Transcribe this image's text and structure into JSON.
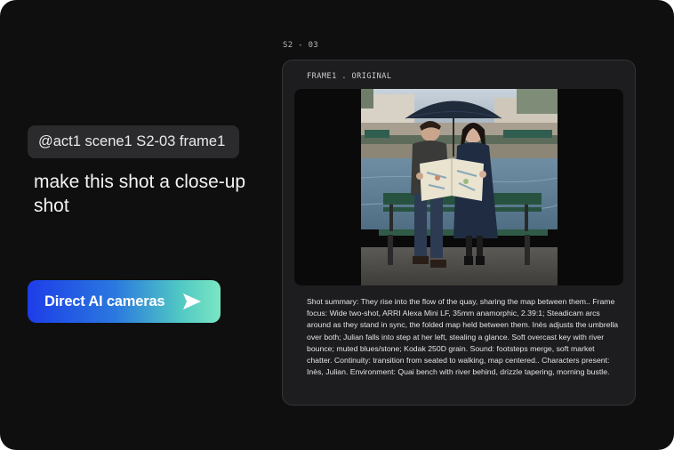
{
  "chat": {
    "mention": "@act1 scene1 S2-03 frame1",
    "prompt": "make this shot a close-up shot"
  },
  "cta": {
    "label": "Direct AI cameras",
    "icon": "send-arrow-icon",
    "gradient": [
      "#1d3de8",
      "#2a78df",
      "#4fc6c4",
      "#7ae6c2"
    ]
  },
  "shot": {
    "id": "S2 - 03",
    "frame_label": "FRAME1 . ORIGINAL",
    "summary": "Shot summary: They rise into the flow of the quay, sharing the map between them.. Frame focus: Wide two-shot, ARRI Alexa Mini LF, 35mm anamorphic, 2.39:1; Steadicam arcs around as they stand in sync, the folded map held between them. Inès adjusts the umbrella over both; Julian falls into step at her left, stealing a glance. Soft overcast key with river bounce; muted blues/stone; Kodak 250D grain. Sound: footsteps merge, soft market chatter. Continuity: transition from seated to walking, map centered.. Characters present: Inès, Julian. Environment: Quai bench with river behind, drizzle tapering, morning bustle."
  },
  "colors": {
    "background": "#0f0f10",
    "card": "#1d1d1f",
    "mention_bg": "#2b2b2d"
  }
}
